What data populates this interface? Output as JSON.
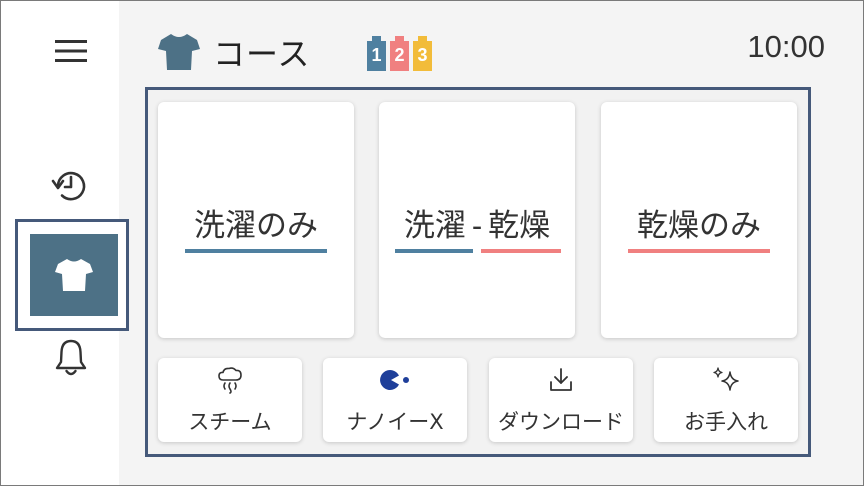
{
  "header": {
    "title": "コース",
    "step_badges": [
      {
        "num": "1",
        "color": "#4f80a0"
      },
      {
        "num": "2",
        "color": "#f08080"
      },
      {
        "num": "3",
        "color": "#f2bc3a"
      }
    ],
    "time": "10:00"
  },
  "sidebar": {
    "items": [
      {
        "name": "menu",
        "icon": "hamburger-menu-icon"
      },
      {
        "name": "history",
        "icon": "history-icon"
      },
      {
        "name": "course",
        "icon": "shirt-icon",
        "selected": true
      },
      {
        "name": "notifications",
        "icon": "bell-icon"
      }
    ]
  },
  "courses": {
    "wash_only": {
      "label": "洗濯のみ",
      "accent": "#4f80a0"
    },
    "wash_dry": {
      "label_wash": "洗濯",
      "separator": "-",
      "label_dry": "乾燥",
      "accent_wash": "#4f80a0",
      "accent_dry": "#f08080"
    },
    "dry_only": {
      "label": "乾燥のみ",
      "accent": "#f08080"
    }
  },
  "functions": [
    {
      "label": "スチーム",
      "icon": "steam-icon"
    },
    {
      "label": "ナノイーX",
      "icon": "nanoe-x-icon"
    },
    {
      "label": "ダウンロード",
      "icon": "download-icon"
    },
    {
      "label": "お手入れ",
      "icon": "sparkle-icon"
    }
  ],
  "colors": {
    "selected_bg": "#4d7186",
    "frame": "#45597a",
    "shirt": "#4d7186",
    "nanoe": "#1f3f9a"
  }
}
